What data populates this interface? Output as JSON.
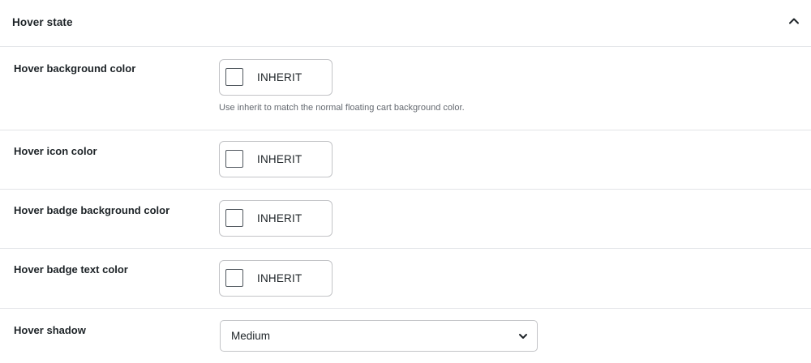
{
  "section": {
    "title": "Hover state",
    "toggle_icon": "chevron-up-icon"
  },
  "fields": {
    "background": {
      "label": "Hover background color",
      "value": "INHERIT",
      "help": "Use inherit to match the normal floating cart background color."
    },
    "icon": {
      "label": "Hover icon color",
      "value": "INHERIT"
    },
    "badge_background": {
      "label": "Hover badge background color",
      "value": "INHERIT"
    },
    "badge_text": {
      "label": "Hover badge text color",
      "value": "INHERIT"
    },
    "shadow": {
      "label": "Hover shadow",
      "selected": "Medium",
      "icon": "chevron-down-icon"
    }
  },
  "colors": {
    "border": "#c3c4c7",
    "divider": "#e2e4e7",
    "text": "#1d2327",
    "help_text": "#646970"
  }
}
